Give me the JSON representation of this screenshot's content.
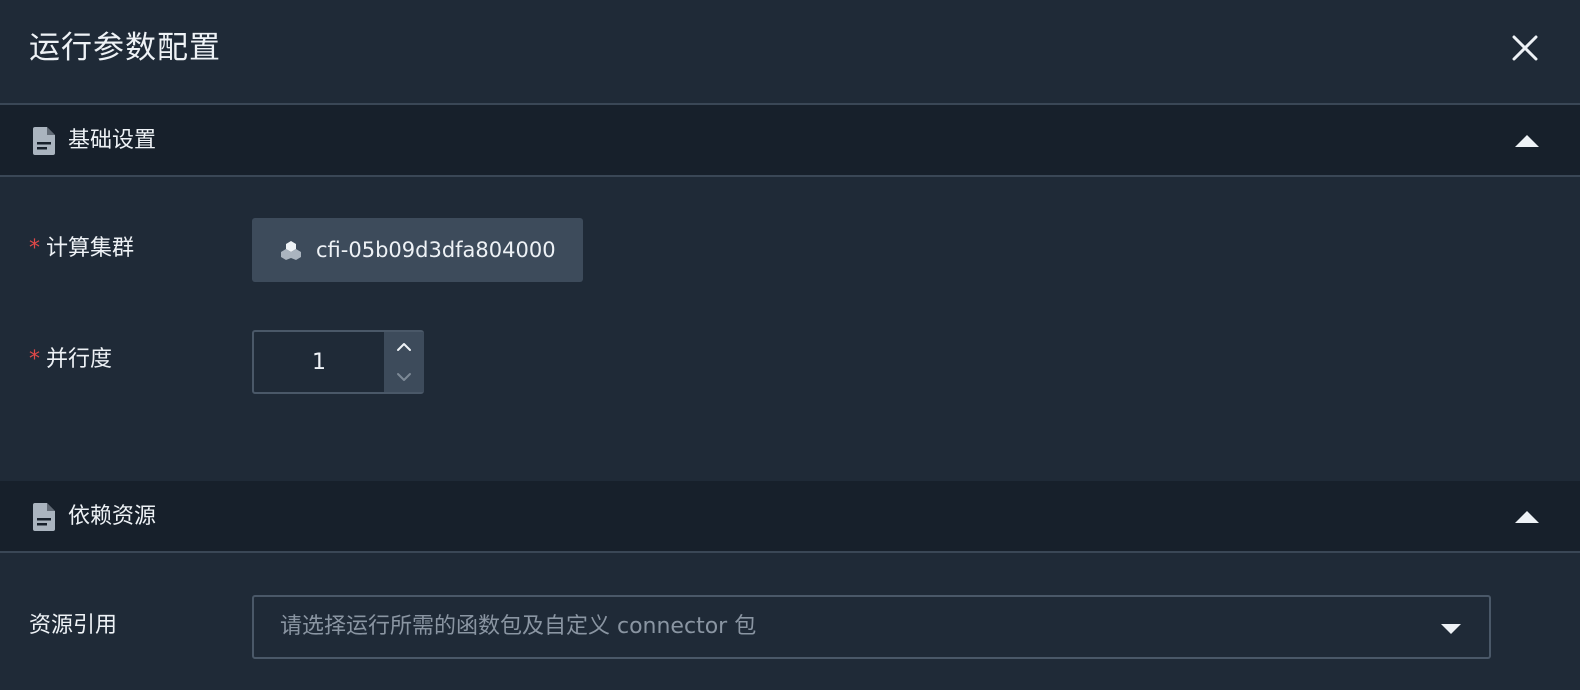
{
  "dialog": {
    "title": "运行参数配置",
    "close_icon": "close-icon"
  },
  "sections": {
    "basic": {
      "title": "基础设置",
      "icon": "document-icon",
      "collapse_icon": "caret-up-icon"
    },
    "dependencies": {
      "title": "依赖资源",
      "icon": "document-icon",
      "collapse_icon": "caret-up-icon"
    }
  },
  "form": {
    "cluster": {
      "required_mark": "*",
      "label": "计算集群",
      "value": "cfi-05b09d3dfa804000",
      "icon": "cluster-icon"
    },
    "parallelism": {
      "required_mark": "*",
      "label": "并行度",
      "value": "1",
      "increment_icon": "chevron-up-icon",
      "decrement_icon": "chevron-down-icon"
    },
    "resource_ref": {
      "label": "资源引用",
      "placeholder": "请选择运行所需的函数包及自定义 connector 包",
      "dropdown_icon": "caret-down-icon"
    }
  },
  "colors": {
    "background": "#1f2a37",
    "section_header_bg": "#17202b",
    "chip_bg": "#3d4b5b",
    "required": "#e04848",
    "placeholder": "#8a95a2"
  }
}
